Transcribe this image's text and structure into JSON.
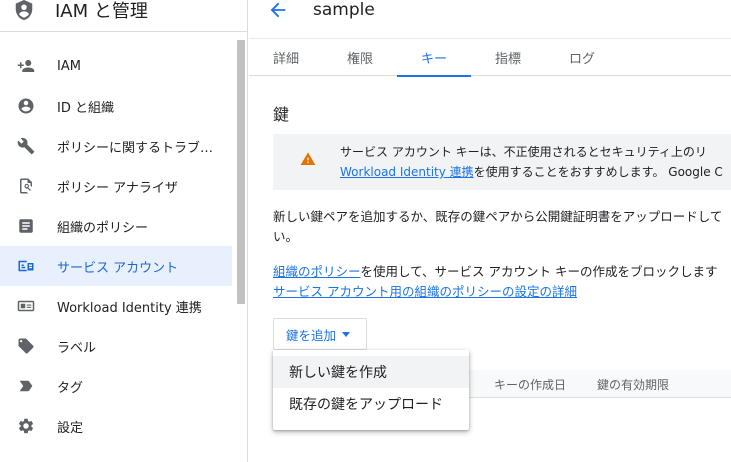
{
  "app": {
    "title": "IAM と管理"
  },
  "sidebar": {
    "items": [
      {
        "label": "IAM",
        "icon": "person-add-icon"
      },
      {
        "label": "ID と組織",
        "icon": "account-circle-icon"
      },
      {
        "label": "ポリシーに関するトラブ…",
        "icon": "wrench-icon"
      },
      {
        "label": "ポリシー アナライザ",
        "icon": "doc-search-icon"
      },
      {
        "label": "組織のポリシー",
        "icon": "list-doc-icon"
      },
      {
        "label": "サービス アカウント",
        "icon": "service-account-icon",
        "active": true
      },
      {
        "label": "Workload Identity 連携",
        "icon": "id-card-icon"
      },
      {
        "label": "ラベル",
        "icon": "tag-icon"
      },
      {
        "label": "タグ",
        "icon": "label-arrow-icon"
      },
      {
        "label": "設定",
        "icon": "gear-icon"
      }
    ]
  },
  "header": {
    "title": "sample"
  },
  "tabs": [
    {
      "label": "詳細"
    },
    {
      "label": "権限"
    },
    {
      "label": "キー",
      "active": true
    },
    {
      "label": "指標"
    },
    {
      "label": "ログ"
    }
  ],
  "main": {
    "section_title": "鍵",
    "warning": {
      "line1": "サービス アカウント キーは、不正使用されるとセキュリティ上のリ",
      "link": "Workload Identity 連携",
      "line2_rest": "を使用することをおすすめします。 Google C"
    },
    "para1": "新しい鍵ペアを追加するか、既存の鍵ペアから公開鍵証明書をアップロードしてい。",
    "para2": {
      "link1": "組織のポリシー",
      "text": "を使用して、サービス アカウント キーの作成をブロックします",
      "link2": "サービス アカウント用の組織のポリシーの設定の詳細"
    },
    "add_key_button": "鍵を追加",
    "table_headers": [
      "キーの作成日",
      "鍵の有効期限"
    ],
    "menu": [
      "新しい鍵を作成",
      "既存の鍵をアップロード"
    ]
  },
  "colors": {
    "accent": "#1a73e8",
    "active_bg": "#e8f0fe",
    "warning": "#e37400"
  }
}
